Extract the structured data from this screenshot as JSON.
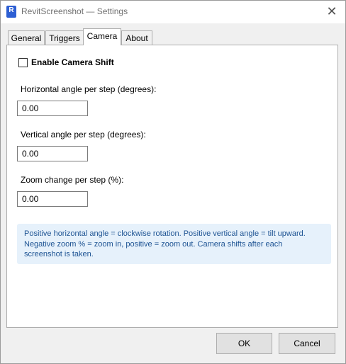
{
  "window": {
    "title": "RevitScreenshot — Settings",
    "app_icon_letter": "R",
    "close_glyph": "✕"
  },
  "tabs": [
    {
      "label": "General",
      "selected": false
    },
    {
      "label": "Triggers",
      "selected": false
    },
    {
      "label": "Camera",
      "selected": true
    },
    {
      "label": "About",
      "selected": false
    }
  ],
  "camera": {
    "enable_label": "Enable Camera Shift",
    "enable_checked": false,
    "horizontal": {
      "label": "Horizontal angle per step (degrees):",
      "value": "0.00"
    },
    "vertical": {
      "label": "Vertical angle per step (degrees):",
      "value": "0.00"
    },
    "zoom": {
      "label": "Zoom change per step (%):",
      "value": "0.00"
    },
    "info_lines": [
      "Positive horizontal angle = clockwise rotation. Positive vertical angle = tilt upward.",
      "Negative zoom % = zoom in, positive = zoom out. Camera shifts after each",
      "screenshot is taken."
    ]
  },
  "buttons": {
    "ok": "OK",
    "cancel": "Cancel"
  },
  "colors": {
    "accent": "#2d5fd3",
    "info_bg": "#e6f1fb",
    "info_text": "#1d5393"
  }
}
